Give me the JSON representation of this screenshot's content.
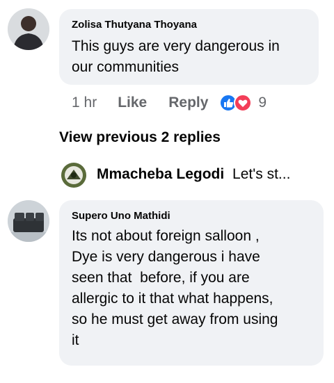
{
  "comments": [
    {
      "author": "Zolisa Thutyana Thoyana",
      "text_lines": [
        "This guys are very dangerous in",
        "our communities"
      ],
      "time": "1 hr",
      "like_label": "Like",
      "reply_label": "Reply",
      "reaction_count": "9"
    },
    {
      "author": "Supero Uno Mathidi",
      "text_lines": [
        "Its not about foreign salloon ,",
        "Dye is very dangerous i have",
        "seen that  before, if you are",
        "allergic to it that what happens,",
        "so he must get away from using",
        "it"
      ]
    }
  ],
  "view_previous": "View previous 2 replies",
  "reply_preview": {
    "author": "Mmacheba Legodi",
    "text": "Let's st..."
  },
  "colors": {
    "bubble": "#f0f2f5",
    "meta_text": "#65676b",
    "like_blue": "#1877f2",
    "love_red": "#f33e58"
  }
}
